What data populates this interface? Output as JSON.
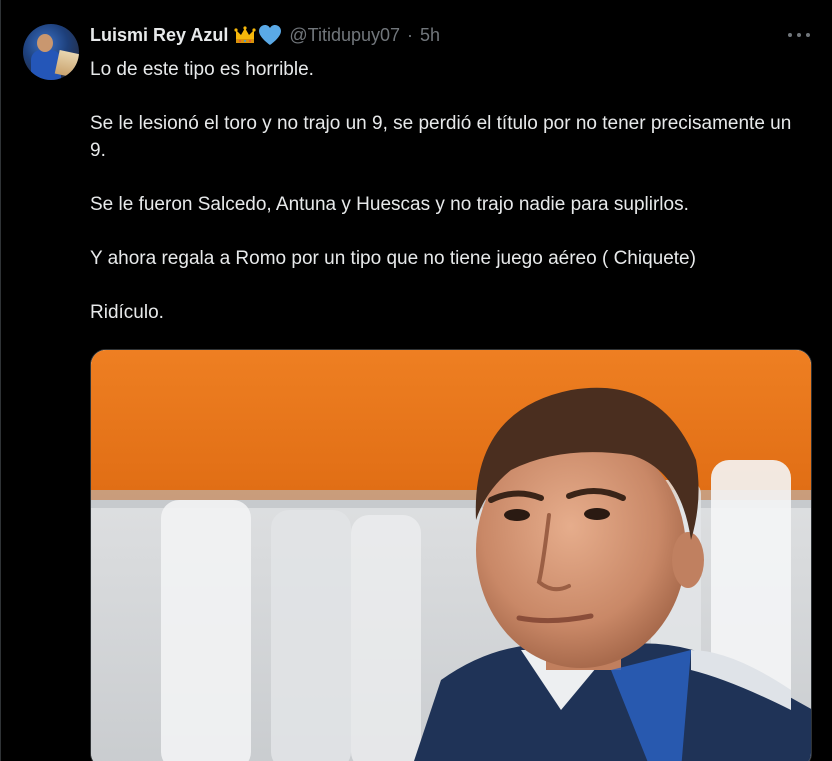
{
  "tweet": {
    "display_name": "Luismi Rey Azul",
    "handle": "@Titidupuy07",
    "separator": "·",
    "time": "5h",
    "paragraphs": [
      "Lo de este tipo es horrible.",
      "Se le lesionó el toro y no trajo un 9, se perdió el título por no tener precisamente un 9.",
      "Se le fueron Salcedo, Antuna y Huescas y no trajo nadie para suplirlos.",
      "Y ahora regala a Romo por un tipo que no tiene juego aéreo ( Chiquete)",
      "Ridículo."
    ]
  },
  "icons": {
    "badge_1": "crown-emoji-icon",
    "badge_2": "blue-heart-emoji-icon",
    "menu": "more-options-icon"
  },
  "colors": {
    "background": "#000000",
    "text": "#e7e9ea",
    "secondary_text": "#71767b",
    "heart": "#5aa9e6",
    "crown": "#f5b70b",
    "photo_wall_orange": "#ea7a1e"
  }
}
